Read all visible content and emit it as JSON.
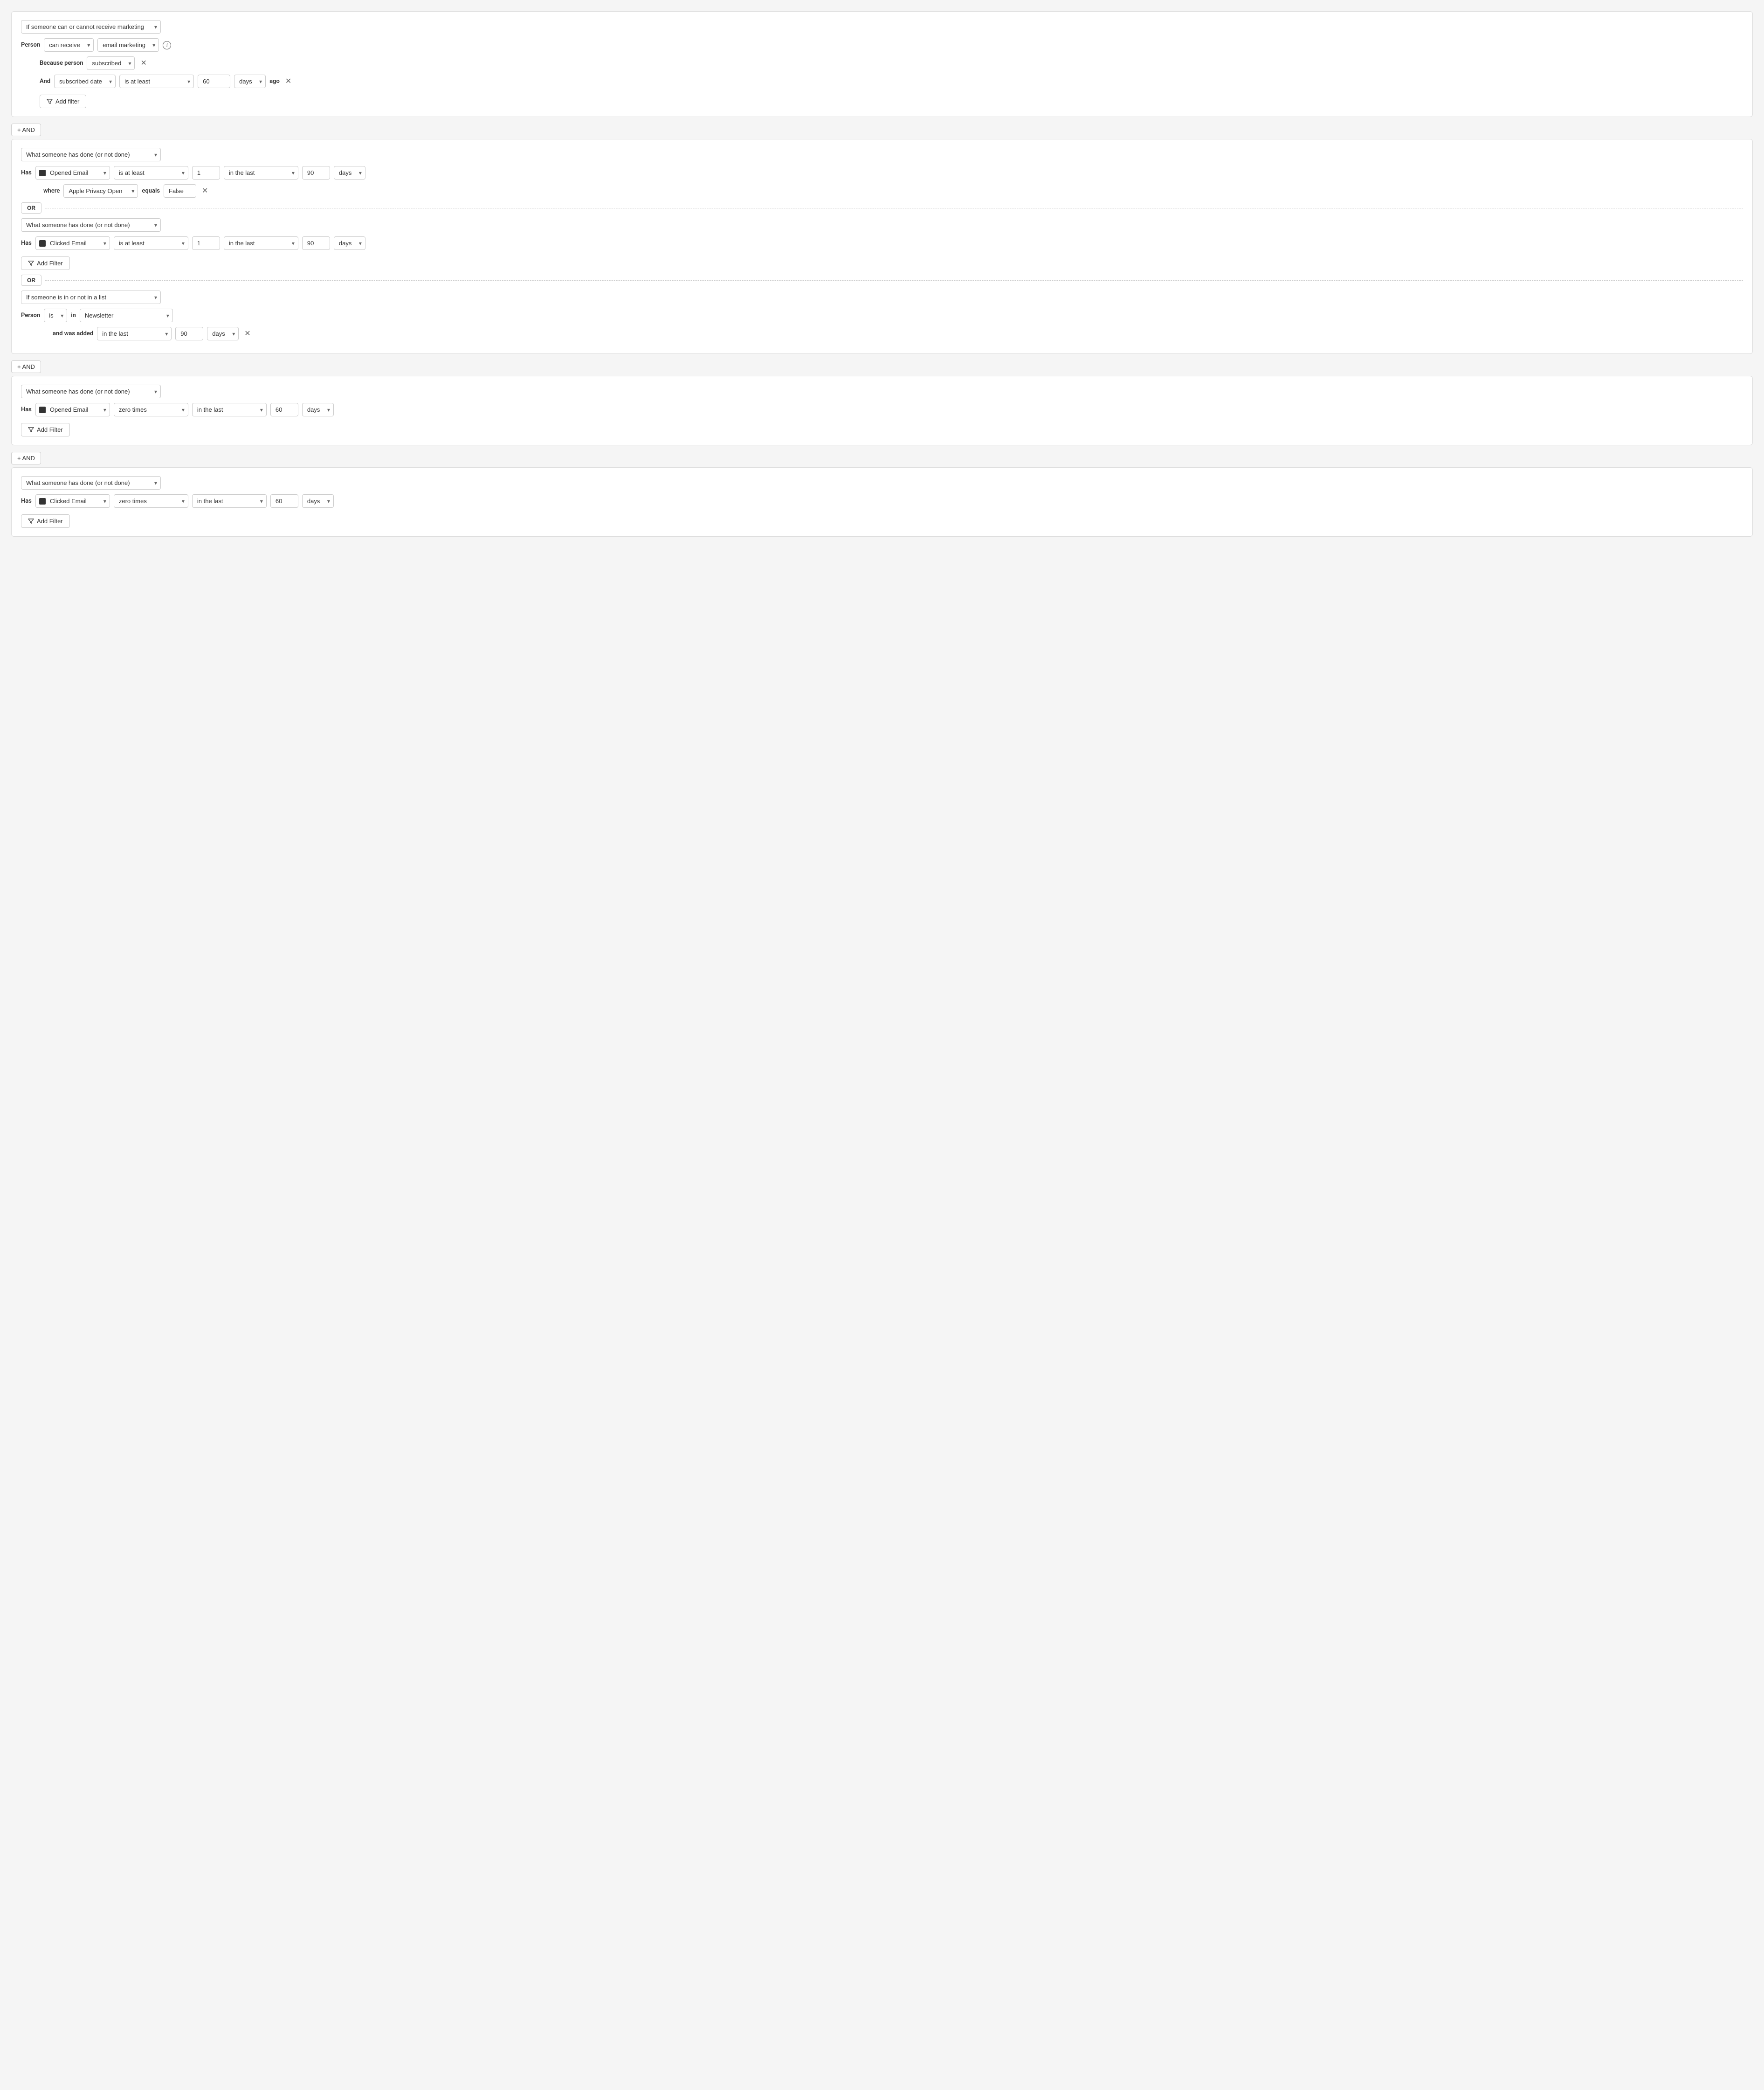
{
  "blocks": [
    {
      "id": "block1",
      "type": "marketing",
      "mainDropdown": "If someone can or cannot receive marketing",
      "personLabel": "Person",
      "canReceive": "can receive",
      "emailMarketing": "email marketing",
      "becausePersonLabel": "Because person",
      "subscribed": "subscribed",
      "andLabel": "And",
      "subscribedDate": "subscribed date",
      "isAtLeast": "is at least",
      "days60": "60",
      "daysUnit": "days",
      "agoLabel": "ago",
      "addFilterLabel": "Add filter"
    },
    {
      "id": "block2",
      "type": "or-group",
      "subBlocks": [
        {
          "id": "block2a",
          "mainDropdown": "What someone has done (or not done)",
          "hasLabel": "Has",
          "event": "Opened Email",
          "condition": "is at least",
          "count": "1",
          "timeCondition": "in the last",
          "timeValue": "90",
          "timeUnit": "days",
          "hasWhere": true,
          "whereField": "Apple Privacy Open",
          "whereOp": "equals",
          "whereValue": "False"
        },
        {
          "id": "block2b",
          "mainDropdown": "What someone has done (or not done)",
          "hasLabel": "Has",
          "event": "Clicked Email",
          "condition": "is at least",
          "count": "1",
          "timeCondition": "in the last",
          "timeValue": "90",
          "timeUnit": "days",
          "hasWhere": false,
          "addFilterLabel": "Add Filter"
        },
        {
          "id": "block2c",
          "type": "list",
          "mainDropdown": "If someone is in or not in a list",
          "personLabel": "Person",
          "personIs": "is",
          "personIn": "in",
          "listName": "Newsletter",
          "andWasAdded": "and was added",
          "timeCondition": "in the last",
          "timeValue": "90",
          "timeUnit": "days"
        }
      ]
    },
    {
      "id": "block3",
      "mainDropdown": "What someone has done (or not done)",
      "hasLabel": "Has",
      "event": "Opened Email",
      "condition": "zero times",
      "timeCondition": "in the last",
      "timeValue": "60",
      "timeUnit": "days",
      "addFilterLabel": "Add Filter"
    },
    {
      "id": "block4",
      "mainDropdown": "What someone has done (or not done)",
      "hasLabel": "Has",
      "event": "Clicked Email",
      "condition": "zero times",
      "timeCondition": "in the last",
      "timeValue": "60",
      "timeUnit": "days",
      "addFilterLabel": "Add Filter"
    }
  ],
  "andLabel": "+ AND",
  "orLabel": "OR"
}
